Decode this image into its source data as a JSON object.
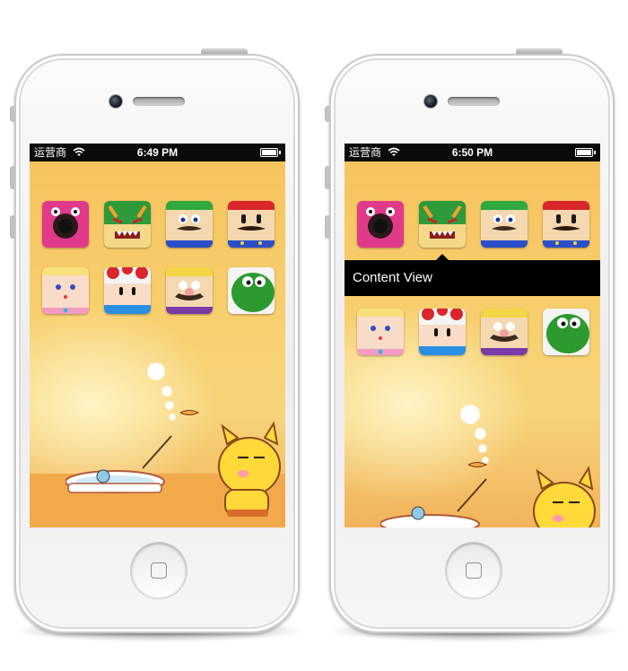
{
  "phones": [
    {
      "status_bar": {
        "carrier": "运营商",
        "time": "6:49 PM"
      },
      "popup": null
    },
    {
      "status_bar": {
        "carrier": "运营商",
        "time": "6:50 PM"
      },
      "popup": {
        "label": "Content View"
      }
    }
  ],
  "apps": [
    {
      "icon": "birdo-face-icon",
      "bg": "#e23a8a"
    },
    {
      "icon": "bowser-face-icon",
      "bg": "#2f9a3b"
    },
    {
      "icon": "luigi-face-icon",
      "bg": "#2fa83d"
    },
    {
      "icon": "mario-face-icon",
      "bg": "#d8262b"
    },
    {
      "icon": "peach-face-icon",
      "bg": "#f7e07a"
    },
    {
      "icon": "toad-face-icon",
      "bg": "#f4f4f4"
    },
    {
      "icon": "wario-face-icon",
      "bg": "#f3d648"
    },
    {
      "icon": "yoshi-face-icon",
      "bg": "#2c9a2e"
    }
  ],
  "colors": {
    "wallpaper_top": "#f6c25c",
    "wallpaper_bottom": "#f1b35b",
    "status_bar": "#0b0b0b",
    "popup": "#000000"
  }
}
